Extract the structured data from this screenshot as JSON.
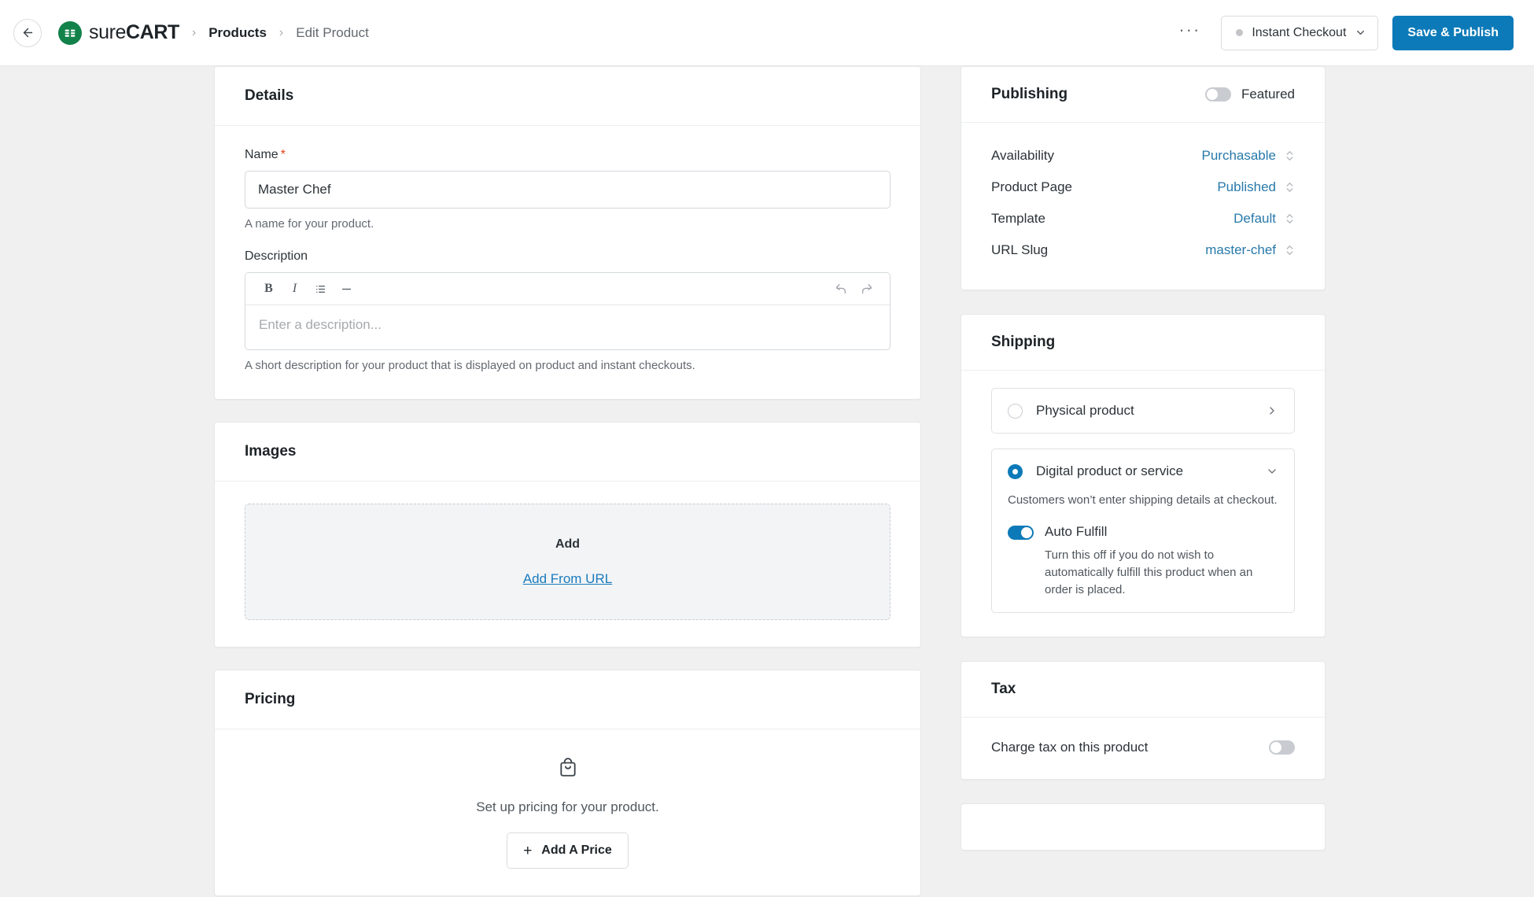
{
  "header": {
    "back_icon": "arrow-left-icon",
    "brand_sure": "sure",
    "brand_cart": "CART",
    "breadcrumb_sep": "›",
    "breadcrumb_products": "Products",
    "breadcrumb_current": "Edit Product",
    "kebab": "···",
    "checkout_label": "Instant Checkout",
    "save_label": "Save & Publish",
    "accent_blue": "#0c7ab8",
    "brand_green": "#12824a"
  },
  "details": {
    "title": "Details",
    "name_label": "Name",
    "name_required": "*",
    "name_value": "Master Chef",
    "name_help": "A name for your product.",
    "description_label": "Description",
    "toolbar": {
      "bold": "B",
      "italic": "I",
      "list": "list-icon",
      "rule": "—",
      "undo": "undo-icon",
      "redo": "redo-icon"
    },
    "description_placeholder": "Enter a description...",
    "description_help": "A short description for your product that is displayed on product and instant checkouts."
  },
  "images": {
    "title": "Images",
    "add_label": "Add",
    "add_from_url": "Add From URL"
  },
  "pricing": {
    "title": "Pricing",
    "icon": "shopping-bag-icon",
    "empty_text": "Set up pricing for your product.",
    "add_price_plus": "+",
    "add_price_label": "Add A Price"
  },
  "publishing": {
    "title": "Publishing",
    "featured_label": "Featured",
    "featured_on": false,
    "rows": [
      {
        "key": "Availability",
        "value": "Purchasable"
      },
      {
        "key": "Product Page",
        "value": "Published"
      },
      {
        "key": "Template",
        "value": "Default"
      },
      {
        "key": "URL Slug",
        "value": "master-chef"
      }
    ]
  },
  "shipping": {
    "title": "Shipping",
    "physical": {
      "label": "Physical product",
      "selected": false,
      "chevron": "chevron-right-icon"
    },
    "digital": {
      "label": "Digital product or service",
      "selected": true,
      "chevron": "chevron-down-icon",
      "description": "Customers won’t enter shipping details at checkout.",
      "auto_fulfill_label": "Auto Fulfill",
      "auto_fulfill_on": true,
      "auto_fulfill_desc": "Turn this off if you do not wish to automatically fulfill this product when an order is placed."
    }
  },
  "tax": {
    "title": "Tax",
    "charge_label": "Charge tax on this product",
    "charge_on": false
  }
}
